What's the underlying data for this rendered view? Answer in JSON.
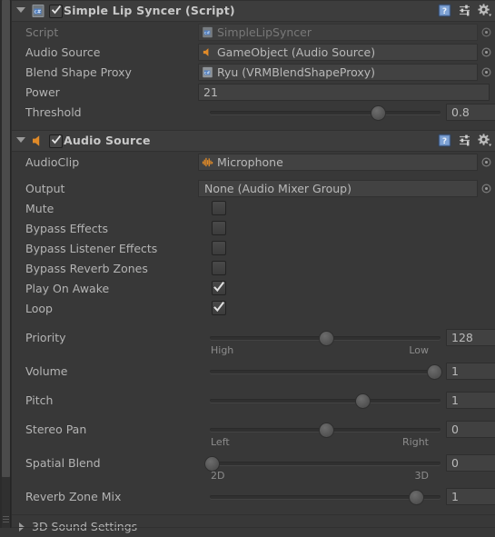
{
  "theme": {
    "background": "#383838",
    "header_background": "#3d3d3d",
    "field_background": "#424242",
    "text": "#b4b4b4",
    "dim_text": "#7d7d7d",
    "accent_orange": "#e08a28",
    "accent_blue": "#4f7ec0"
  },
  "components": [
    {
      "id": "simple-lip-syncer",
      "title": "Simple Lip Syncer (Script)",
      "icon": "script-icon",
      "enabled": true,
      "expanded": true,
      "header_buttons": [
        {
          "name": "help-icon",
          "label": "?"
        },
        {
          "name": "preset-icon",
          "label": "Preset"
        },
        {
          "name": "gear-icon",
          "label": "More"
        }
      ],
      "rows": [
        {
          "type": "object",
          "label": "Script",
          "value": "SimpleLipSyncer",
          "icon": "script-icon",
          "disabled": true,
          "picker": true
        },
        {
          "type": "object",
          "label": "Audio Source",
          "value": "GameObject (Audio Source)",
          "icon": "speaker-icon",
          "disabled": false,
          "picker": true
        },
        {
          "type": "object",
          "label": "Blend Shape Proxy",
          "value": "Ryu (VRMBlendShapeProxy)",
          "icon": "script-icon",
          "disabled": false,
          "picker": true
        },
        {
          "type": "number",
          "label": "Power",
          "value": "21"
        },
        {
          "type": "slider",
          "label": "Threshold",
          "value": "0.8",
          "fill": 0.8,
          "left_label": "",
          "right_label": ""
        }
      ]
    },
    {
      "id": "audio-source",
      "title": "Audio Source",
      "icon": "speaker-icon",
      "enabled": true,
      "expanded": true,
      "header_buttons": [
        {
          "name": "help-icon",
          "label": "?"
        },
        {
          "name": "preset-icon",
          "label": "Preset"
        },
        {
          "name": "gear-icon",
          "label": "More"
        }
      ],
      "rows": [
        {
          "type": "object",
          "label": "AudioClip",
          "value": "Microphone",
          "icon": "waveform-icon",
          "disabled": false,
          "picker": true
        },
        {
          "type": "object",
          "label": "Output",
          "value": "None (Audio Mixer Group)",
          "icon": "none",
          "disabled": false,
          "picker": true
        },
        {
          "type": "checkbox",
          "label": "Mute",
          "checked": false
        },
        {
          "type": "checkbox",
          "label": "Bypass Effects",
          "checked": false
        },
        {
          "type": "checkbox",
          "label": "Bypass Listener Effects",
          "checked": false
        },
        {
          "type": "checkbox",
          "label": "Bypass Reverb Zones",
          "checked": false
        },
        {
          "type": "checkbox",
          "label": "Play On Awake",
          "checked": true
        },
        {
          "type": "checkbox",
          "label": "Loop",
          "checked": true
        },
        {
          "type": "slider",
          "label": "Priority",
          "value": "128",
          "fill": 0.5,
          "left_label": "High",
          "right_label": "Low"
        },
        {
          "type": "slider",
          "label": "Volume",
          "value": "1",
          "fill": 1.0,
          "left_label": "",
          "right_label": ""
        },
        {
          "type": "slider",
          "label": "Pitch",
          "value": "1",
          "fill": 0.66,
          "left_label": "",
          "right_label": ""
        },
        {
          "type": "slider",
          "label": "Stereo Pan",
          "value": "0",
          "fill": 0.5,
          "left_label": "Left",
          "right_label": "Right"
        },
        {
          "type": "slider",
          "label": "Spatial Blend",
          "value": "0",
          "fill": 0.0,
          "left_label": "2D",
          "right_label": "3D"
        },
        {
          "type": "slider",
          "label": "Reverb Zone Mix",
          "value": "1",
          "fill": 0.9,
          "left_label": "",
          "right_label": ""
        }
      ],
      "footer_foldout": {
        "label": "3D Sound Settings",
        "expanded": false
      }
    }
  ]
}
